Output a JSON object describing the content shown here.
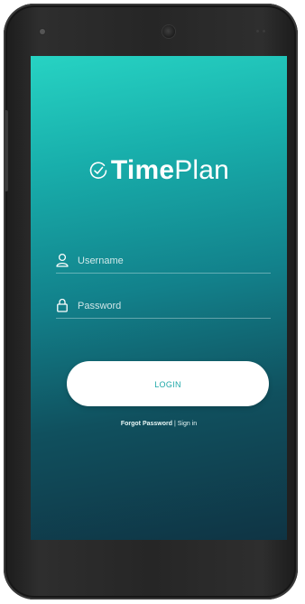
{
  "app": {
    "logo_bold": "Time",
    "logo_light": "Plan",
    "logo_icon": "clock-check-icon"
  },
  "login_form": {
    "username_placeholder": "Username",
    "username_icon": "user-icon",
    "password_placeholder": "Password",
    "password_icon": "lock-icon",
    "login_label": "LOGIN",
    "forgot_password_label": "Forgot Password",
    "separator": "|",
    "sign_in_label": "Sign in"
  },
  "colors": {
    "gradient_top": "#27d3c3",
    "gradient_bottom": "#0f3444",
    "button_bg": "#ffffff",
    "button_text": "#1ea8a8"
  }
}
